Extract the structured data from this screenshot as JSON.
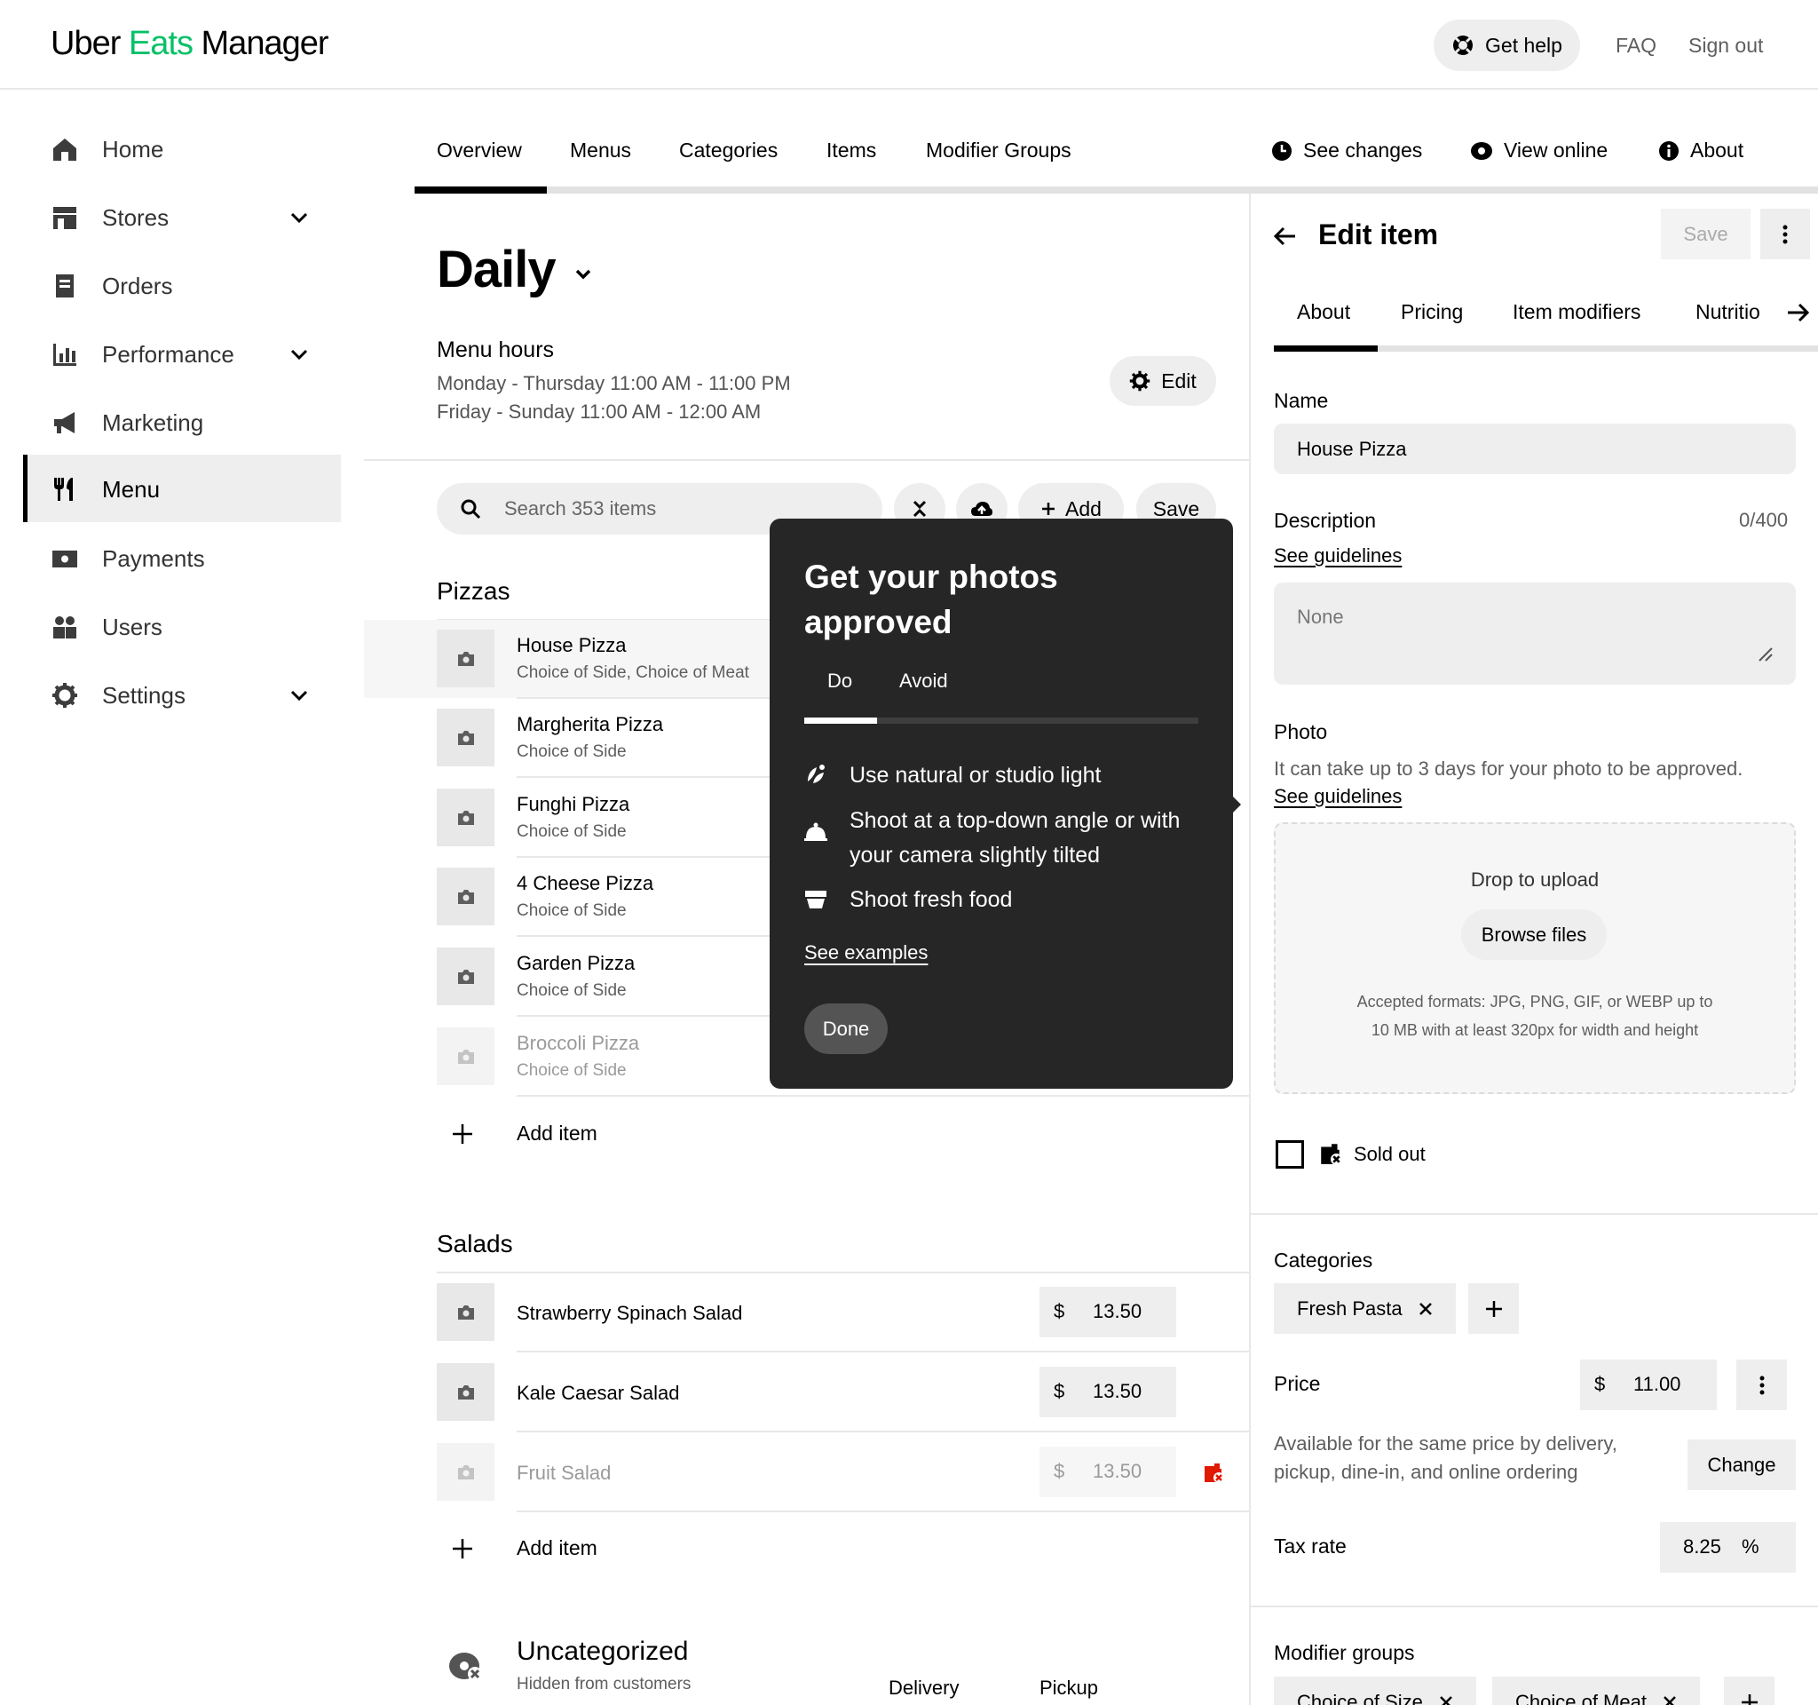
{
  "header": {
    "logo_part1": "Uber ",
    "logo_part2": "Eats",
    "logo_part3": " Manager",
    "get_help": "Get help",
    "faq": "FAQ",
    "sign_out": "Sign out",
    "brand_green": "#06c167"
  },
  "sidebar": {
    "items": [
      {
        "label": "Home",
        "icon": "home-icon"
      },
      {
        "label": "Stores",
        "icon": "store-icon"
      },
      {
        "label": "Orders",
        "icon": "orders-icon"
      },
      {
        "label": "Performance",
        "icon": "bar-chart-icon"
      },
      {
        "label": "Marketing",
        "icon": "megaphone-icon"
      },
      {
        "label": "Menu",
        "icon": "fork-knife-icon"
      },
      {
        "label": "Payments",
        "icon": "payments-icon"
      },
      {
        "label": "Users",
        "icon": "users-icon"
      },
      {
        "label": "Settings",
        "icon": "gear-icon"
      }
    ]
  },
  "tabs": [
    "Overview",
    "Menus",
    "Categories",
    "Items",
    "Modifier Groups"
  ],
  "actions": {
    "see_changes": "See changes",
    "view_online": "View online",
    "about": "About"
  },
  "menu": {
    "title": "Daily",
    "hours_label": "Menu hours",
    "hours_line1": "Monday - Thursday 11:00 AM - 11:00 PM",
    "hours_line2": "Friday - Sunday 11:00 AM - 12:00 AM",
    "edit": "Edit",
    "search_placeholder": "Search 353 items",
    "add": "Add",
    "save": "Save"
  },
  "pizzas": {
    "title": "Pizzas",
    "items": [
      {
        "name": "House Pizza",
        "sub": "Choice of Side, Choice of Meat"
      },
      {
        "name": "Margherita Pizza",
        "sub": "Choice of Side"
      },
      {
        "name": "Funghi Pizza",
        "sub": "Choice of Side"
      },
      {
        "name": "4 Cheese Pizza",
        "sub": "Choice of Side"
      },
      {
        "name": "Garden Pizza",
        "sub": "Choice of Side"
      },
      {
        "name": "Broccoli Pizza",
        "sub": "Choice of Side"
      }
    ],
    "add_item": "Add item"
  },
  "salads": {
    "title": "Salads",
    "items": [
      {
        "name": "Strawberry Spinach Salad",
        "currency": "$",
        "price": "13.50"
      },
      {
        "name": "Kale Caesar Salad",
        "currency": "$",
        "price": "13.50"
      },
      {
        "name": "Fruit Salad",
        "currency": "$",
        "price": "13.50"
      }
    ],
    "add_item": "Add item"
  },
  "uncategorized": {
    "title": "Uncategorized",
    "sub": "Hidden from customers",
    "col_delivery": "Delivery",
    "col_pickup": "Pickup"
  },
  "tooltip": {
    "title": "Get your photos approved",
    "tab_do": "Do",
    "tab_avoid": "Avoid",
    "tips": [
      "Use natural or studio light",
      "Shoot at a top-down angle or with your camera slightly tilted",
      "Shoot fresh food"
    ],
    "see_examples": "See examples",
    "done": "Done"
  },
  "panel": {
    "title": "Edit item",
    "save": "Save",
    "tabs": [
      "About",
      "Pricing",
      "Item modifiers",
      "Nutritio"
    ],
    "name_label": "Name",
    "name_value": "House Pizza",
    "description_label": "Description",
    "description_count": "0/400",
    "see_guidelines": "See guidelines",
    "description_placeholder": "None",
    "photo_label": "Photo",
    "photo_note": "It can take up to 3 days for your photo to be approved.",
    "drop_to_upload": "Drop to upload",
    "browse_files": "Browse files",
    "formats_line1": "Accepted formats: JPG, PNG, GIF, or WEBP up to",
    "formats_line2": "10 MB with at least 320px for width and height",
    "sold_out": "Sold out",
    "categories_label": "Categories",
    "category_chip": "Fresh Pasta",
    "price_label": "Price",
    "price_currency": "$",
    "price_value": "11.00",
    "price_note_line1": "Available for the same price by delivery,",
    "price_note_line2": "pickup, dine-in, and online ordering",
    "change": "Change",
    "tax_label": "Tax rate",
    "tax_value": "8.25",
    "tax_unit": "%",
    "modifier_groups_label": "Modifier groups",
    "modifier_chips": [
      "Choice of Size",
      "Choice of Meat"
    ]
  }
}
